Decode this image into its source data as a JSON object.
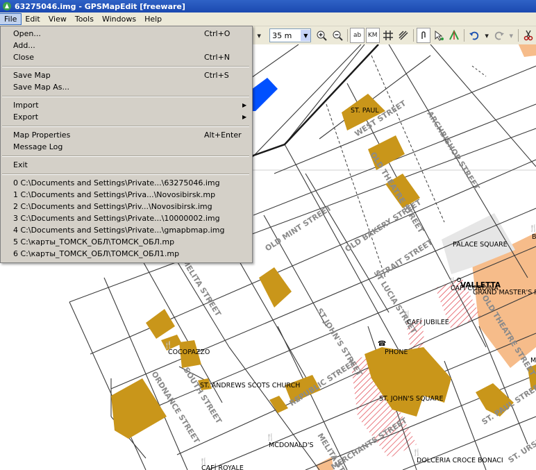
{
  "window": {
    "title": "63275046.img - GPSMapEdit [freeware]"
  },
  "menubar": {
    "items": [
      "File",
      "Edit",
      "View",
      "Tools",
      "Windows",
      "Help"
    ]
  },
  "toolbar": {
    "zoom": "35 m",
    "ab": "ab",
    "km": "KM"
  },
  "file_menu": {
    "open": "Open...",
    "open_sc": "Ctrl+O",
    "add": "Add...",
    "close": "Close",
    "close_sc": "Ctrl+N",
    "save": "Save Map",
    "save_sc": "Ctrl+S",
    "save_as": "Save Map As...",
    "import": "Import",
    "export": "Export",
    "props": "Map Properties",
    "props_sc": "Alt+Enter",
    "log": "Message Log",
    "exit": "Exit",
    "recent": [
      "0 C:\\Documents and Settings\\Private...\\63275046.img",
      "1 C:\\Documents and Settings\\Priva...\\Novosibirsk.mp",
      "2 C:\\Documents and Settings\\Priv...\\Novosibirsk.img",
      "3 C:\\Documents and Settings\\Private...\\10000002.img",
      "4 C:\\Documents and Settings\\Private...\\gmapbmap.img",
      "5 C:\\карты_ТОМСК_ОБЛ\\ТОМСК_ОБЛ.mp",
      "6 C:\\карты_ТОМСК_ОБЛ\\ТОМСК_ОБЛ1.mp"
    ]
  },
  "map": {
    "streets": {
      "west": "WEST STREET",
      "archbishop": "ARCHBISHOP STREET",
      "old_theatre": "OLD THEATRE STREET",
      "old_mint": "OLD MINT STREET",
      "old_bakery": "OLD BAKERY STREET",
      "strait": "STRAIT STREET",
      "st_lucia": "ST LUCIA STREET",
      "melita1": "MELITA STREET",
      "st_johns": "ST JOHN'S STREET",
      "ordnance": "ORDNANCE STREET",
      "south": "SOUTH STREET",
      "republic": "REPUBLIC STREET",
      "merchants": "MERCHANTS STREET",
      "melita2": "MELITA STREET",
      "st_paul": "ST. PAUL STREET",
      "st_ursula": "ST. URSULA",
      "grand_master": "OLD THEATRE STREET"
    },
    "pois": {
      "st_paul": "ST. PAUL",
      "palace_square": "PALACE SQUARE",
      "valletta": "VALLETTA",
      "cafe_cordina": "CAFÍ CORDINA",
      "grand_masters": "GRAND MASTER'S P...",
      "cafe_jubilee": "CAFÍ JUBILEE",
      "phone": "PHONE",
      "cocopazzo": "COCOPAZZO",
      "st_andrews": "ST. ANDREWS SCOTS CHURCH",
      "st_johns_square": "ST. JOHN'S SQUARE",
      "mcdonalds": "MCDONALD'S",
      "dolceria": "DOLCERIA CROCE BONACI",
      "caffe_royale": "CAFÍ ROYALE",
      "b_edge": "B",
      "m_edge": "M"
    }
  },
  "colors": {
    "building": "#c9961a",
    "road": "#3a3a3a",
    "street_label": "#8a8a8a",
    "water": "#0050ff",
    "orange_area": "#f6bc8a",
    "plaza": "#e6e6e6",
    "hatched": "#e0404a",
    "menu_bg": "#d4d0c8",
    "title_bg": "#1f4fb5"
  }
}
